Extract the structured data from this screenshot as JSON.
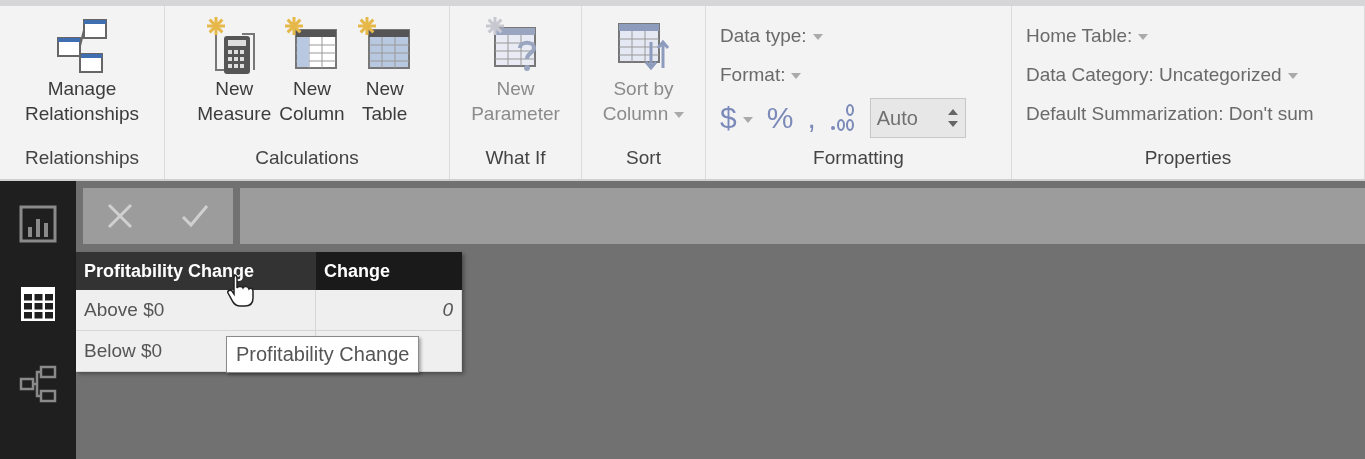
{
  "ribbon": {
    "groups": [
      {
        "label": "Relationships",
        "kind": "buttons",
        "items": [
          {
            "lines": [
              "Manage",
              "Relationships"
            ],
            "disabled": false,
            "dropdown": false
          }
        ]
      },
      {
        "label": "Calculations",
        "kind": "buttons",
        "items": [
          {
            "lines": [
              "New",
              "Measure"
            ],
            "disabled": false,
            "dropdown": false
          },
          {
            "lines": [
              "New",
              "Column"
            ],
            "disabled": false,
            "dropdown": false
          },
          {
            "lines": [
              "New",
              "Table"
            ],
            "disabled": false,
            "dropdown": false
          }
        ]
      },
      {
        "label": "What If",
        "kind": "buttons",
        "items": [
          {
            "lines": [
              "New",
              "Parameter"
            ],
            "disabled": true,
            "dropdown": false
          }
        ]
      },
      {
        "label": "Sort",
        "kind": "buttons",
        "items": [
          {
            "lines": [
              "Sort by",
              "Column"
            ],
            "disabled": true,
            "dropdown": true
          }
        ]
      },
      {
        "label": "Formatting",
        "kind": "formatting",
        "fields": [
          "Data type:",
          "Format:"
        ],
        "symbols": [
          "$",
          "%",
          ","
        ],
        "decimals": "Auto"
      },
      {
        "label": "Properties",
        "kind": "properties",
        "fields": [
          {
            "text": "Home Table:",
            "dropdown": true
          },
          {
            "text": "Data Category: Uncategorized",
            "dropdown": true
          },
          {
            "text": "Default Summarization: Don't sum",
            "dropdown": false
          }
        ]
      }
    ]
  },
  "nav": {
    "items": [
      {
        "selected": false
      },
      {
        "selected": true
      },
      {
        "selected": false
      }
    ]
  },
  "table": {
    "columns": [
      "Profitability Change",
      "Change"
    ],
    "rows": [
      [
        "Above $0",
        "0"
      ],
      [
        "Below $0"
      ]
    ]
  },
  "tooltip": "Profitability Change"
}
